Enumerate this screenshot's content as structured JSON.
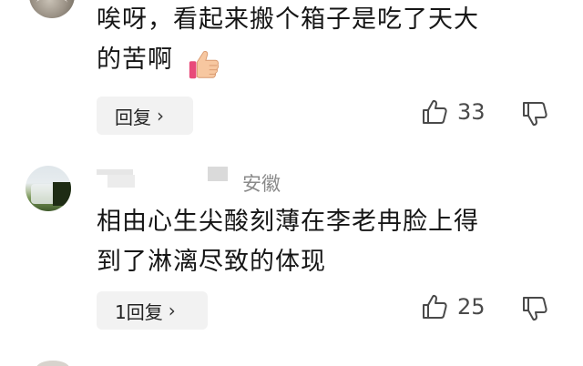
{
  "comment1": {
    "text": "唉呀，看起来搬个箱子是吃了天大\n的苦啊",
    "emoji": "thumbs-up-emoji",
    "reply_label": "回复",
    "likes": "33"
  },
  "comment2": {
    "location": "安徽",
    "text": "相由心生尖酸刻薄在李老冉脸上得\n到了淋漓尽致的体现",
    "reply_label": "1回复",
    "likes": "25"
  },
  "icons": {
    "like": "thumbs-up-outline-icon",
    "dislike": "thumbs-down-outline-icon",
    "chevron": "chevron-right-icon"
  },
  "colors": {
    "pill_bg": "#f2f2f2",
    "muted_text": "#8a8a8a"
  }
}
